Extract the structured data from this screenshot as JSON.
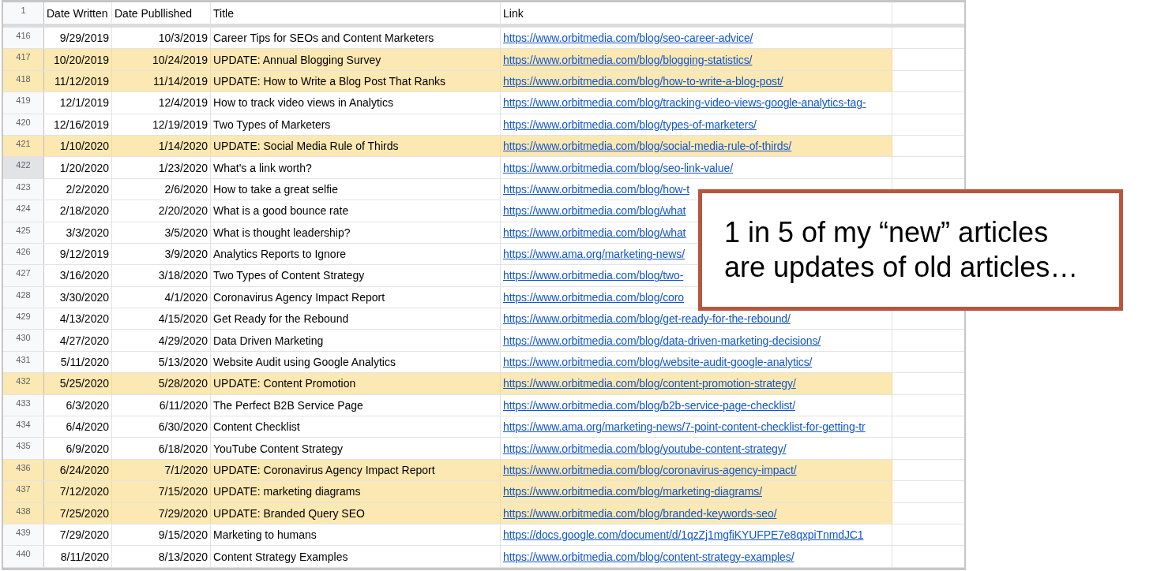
{
  "sheet": {
    "header_row": {
      "number": "1",
      "columns": [
        "Date Written",
        "Date Publlished",
        "Title",
        "Link"
      ]
    },
    "rows": [
      {
        "number": "416",
        "date_written": "9/29/2019",
        "date_published": "10/3/2019",
        "title": "Career Tips for SEOs and Content Marketers",
        "link": "https://www.orbitmedia.com/blog/seo-career-advice/",
        "highlighted": false,
        "selected": false
      },
      {
        "number": "417",
        "date_written": "10/20/2019",
        "date_published": "10/24/2019",
        "title": "UPDATE: Annual Blogging Survey",
        "link": "https://www.orbitmedia.com/blog/blogging-statistics/",
        "highlighted": true,
        "selected": false
      },
      {
        "number": "418",
        "date_written": "11/12/2019",
        "date_published": "11/14/2019",
        "title": "UPDATE: How to Write a Blog Post That Ranks",
        "link": "https://www.orbitmedia.com/blog/how-to-write-a-blog-post/",
        "highlighted": true,
        "selected": false
      },
      {
        "number": "419",
        "date_written": "12/1/2019",
        "date_published": "12/4/2019",
        "title": "How to track video views in Analytics",
        "link": "https://www.orbitmedia.com/blog/tracking-video-views-google-analytics-tag-",
        "highlighted": false,
        "selected": false
      },
      {
        "number": "420",
        "date_written": "12/16/2019",
        "date_published": "12/19/2019",
        "title": "Two Types of Marketers",
        "link": "https://www.orbitmedia.com/blog/types-of-marketers/",
        "highlighted": false,
        "selected": false
      },
      {
        "number": "421",
        "date_written": "1/10/2020",
        "date_published": "1/14/2020",
        "title": "UPDATE: Social Media Rule of Thirds",
        "link": "https://www.orbitmedia.com/blog/social-media-rule-of-thirds/",
        "highlighted": true,
        "selected": false
      },
      {
        "number": "422",
        "date_written": "1/20/2020",
        "date_published": "1/23/2020",
        "title": "What's a link worth?",
        "link": "https://www.orbitmedia.com/blog/seo-link-value/",
        "highlighted": false,
        "selected": true
      },
      {
        "number": "423",
        "date_written": "2/2/2020",
        "date_published": "2/6/2020",
        "title": "How to take a great selfie",
        "link": "https://www.orbitmedia.com/blog/how-t",
        "highlighted": false,
        "selected": false
      },
      {
        "number": "424",
        "date_written": "2/18/2020",
        "date_published": "2/20/2020",
        "title": "What is a good bounce rate",
        "link": "https://www.orbitmedia.com/blog/what",
        "highlighted": false,
        "selected": false
      },
      {
        "number": "425",
        "date_written": "3/3/2020",
        "date_published": "3/5/2020",
        "title": "What is thought leadership?",
        "link": "https://www.orbitmedia.com/blog/what",
        "highlighted": false,
        "selected": false
      },
      {
        "number": "426",
        "date_written": "9/12/2019",
        "date_published": "3/9/2020",
        "title": "Analytics Reports to Ignore",
        "link": "https://www.ama.org/marketing-news/",
        "highlighted": false,
        "selected": false
      },
      {
        "number": "427",
        "date_written": "3/16/2020",
        "date_published": "3/18/2020",
        "title": "Two Types of Content Strategy",
        "link": "https://www.orbitmedia.com/blog/two-",
        "highlighted": false,
        "selected": false
      },
      {
        "number": "428",
        "date_written": "3/30/2020",
        "date_published": "4/1/2020",
        "title": "Coronavirus Agency Impact Report",
        "link": "https://www.orbitmedia.com/blog/coro",
        "highlighted": false,
        "selected": false
      },
      {
        "number": "429",
        "date_written": "4/13/2020",
        "date_published": "4/15/2020",
        "title": "Get Ready for the Rebound",
        "link": "https://www.orbitmedia.com/blog/get-ready-for-the-rebound/",
        "highlighted": false,
        "selected": false
      },
      {
        "number": "430",
        "date_written": "4/27/2020",
        "date_published": "4/29/2020",
        "title": "Data Driven Marketing",
        "link": "https://www.orbitmedia.com/blog/data-driven-marketing-decisions/",
        "highlighted": false,
        "selected": false
      },
      {
        "number": "431",
        "date_written": "5/11/2020",
        "date_published": "5/13/2020",
        "title": "Website Audit using Google Analytics",
        "link": "https://www.orbitmedia.com/blog/website-audit-google-analytics/",
        "highlighted": false,
        "selected": false
      },
      {
        "number": "432",
        "date_written": "5/25/2020",
        "date_published": "5/28/2020",
        "title": "UPDATE: Content Promotion",
        "link": "https://www.orbitmedia.com/blog/content-promotion-strategy/",
        "highlighted": true,
        "selected": false
      },
      {
        "number": "433",
        "date_written": "6/3/2020",
        "date_published": "6/11/2020",
        "title": "The Perfect B2B Service Page",
        "link": "https://www.orbitmedia.com/blog/b2b-service-page-checklist/",
        "highlighted": false,
        "selected": false
      },
      {
        "number": "434",
        "date_written": "6/4/2020",
        "date_published": "6/30/2020",
        "title": "Content Checklist",
        "link": "https://www.ama.org/marketing-news/7-point-content-checklist-for-getting-tr",
        "highlighted": false,
        "selected": false
      },
      {
        "number": "435",
        "date_written": "6/9/2020",
        "date_published": "6/18/2020",
        "title": "YouTube Content Strategy",
        "link": "https://www.orbitmedia.com/blog/youtube-content-strategy/",
        "highlighted": false,
        "selected": false
      },
      {
        "number": "436",
        "date_written": "6/24/2020",
        "date_published": "7/1/2020",
        "title": "UPDATE: Coronavirus Agency Impact Report",
        "link": "https://www.orbitmedia.com/blog/coronavirus-agency-impact/",
        "highlighted": true,
        "selected": false
      },
      {
        "number": "437",
        "date_written": "7/12/2020",
        "date_published": "7/15/2020",
        "title": "UPDATE: marketing diagrams",
        "link": "https://www.orbitmedia.com/blog/marketing-diagrams/",
        "highlighted": true,
        "selected": false
      },
      {
        "number": "438",
        "date_written": "7/25/2020",
        "date_published": "7/29/2020",
        "title": "UPDATE: Branded Query SEO",
        "link": "https://www.orbitmedia.com/blog/branded-keywords-seo/",
        "highlighted": true,
        "selected": false
      },
      {
        "number": "439",
        "date_written": "7/29/2020",
        "date_published": "9/15/2020",
        "title": "Marketing to humans",
        "link": "https://docs.google.com/document/d/1qzZj1mgfiKYUFPE7e8qxpiTnmdJC1",
        "highlighted": false,
        "selected": false
      },
      {
        "number": "440",
        "date_written": "8/11/2020",
        "date_published": "8/13/2020",
        "title": "Content Strategy Examples",
        "link": "https://www.orbitmedia.com/blog/content-strategy-examples/",
        "highlighted": false,
        "selected": false
      }
    ]
  },
  "callout": {
    "text": "1 in 5 of my “new” articles are updates of old articles…"
  }
}
